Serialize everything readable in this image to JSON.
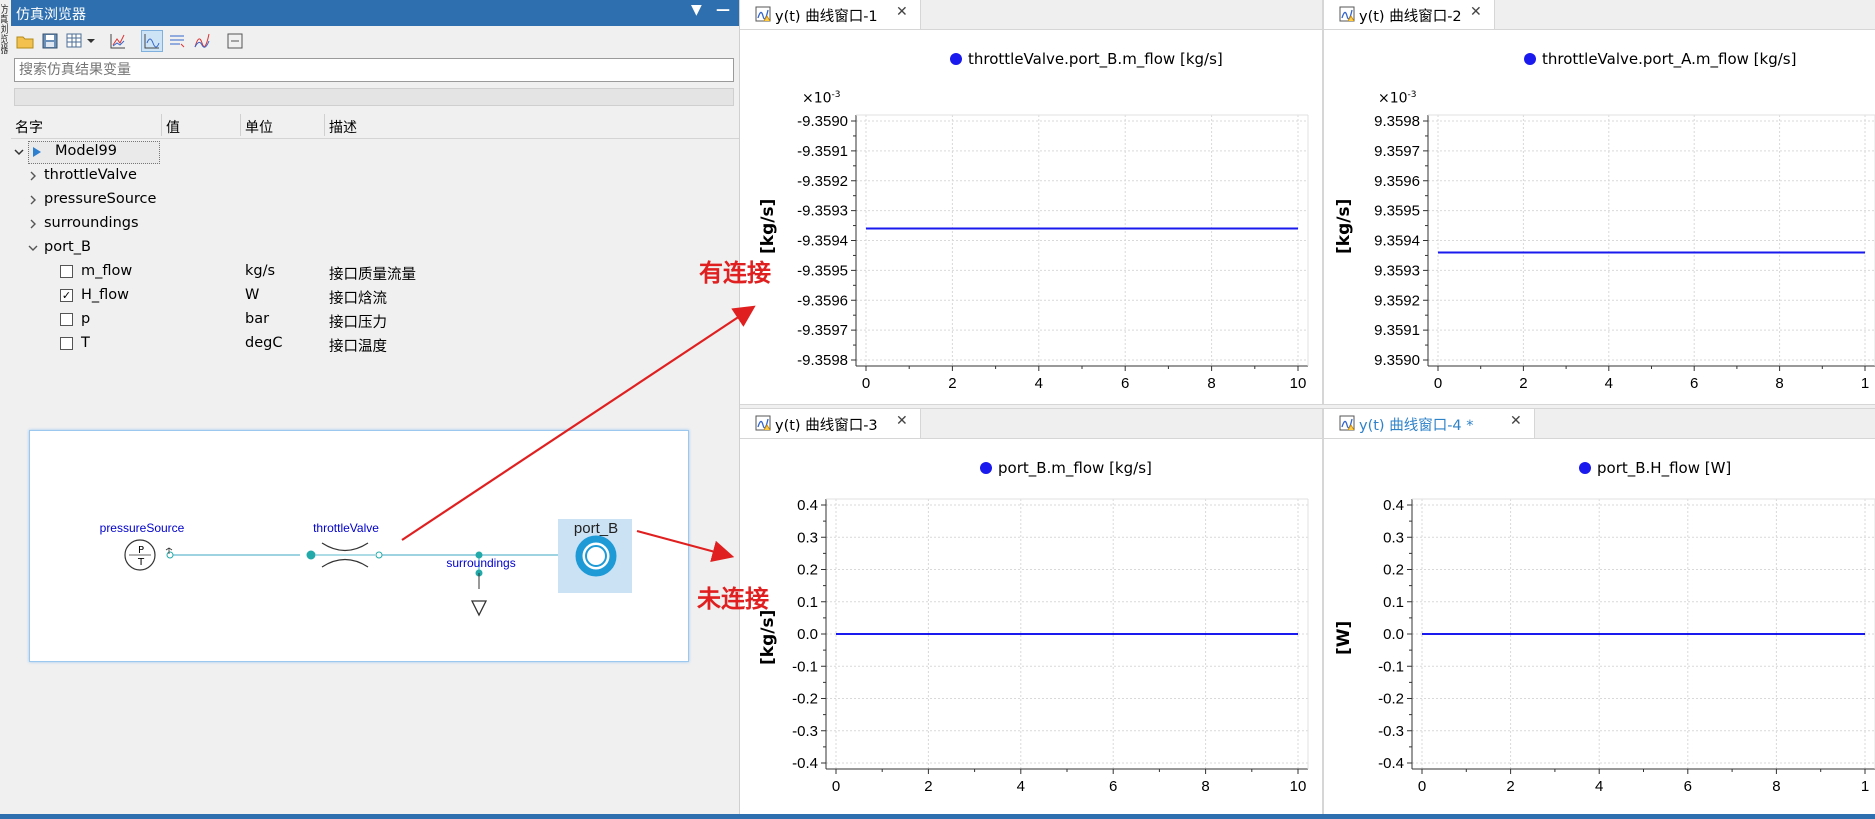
{
  "window": {
    "panel_title": "仿真浏览器",
    "side_tab": "仿真浏览器"
  },
  "search": {
    "placeholder": "搜索仿真结果变量"
  },
  "tree": {
    "columns": [
      "名字",
      "值",
      "单位",
      "描述"
    ],
    "root": "Model99",
    "items": [
      {
        "name": "throttleValve",
        "expanded": false
      },
      {
        "name": "pressureSource",
        "expanded": false
      },
      {
        "name": "surroundings",
        "expanded": false
      },
      {
        "name": "port_B",
        "expanded": true
      }
    ],
    "port_B_children": [
      {
        "name": "m_flow",
        "unit": "kg/s",
        "desc": "接口质量流量",
        "checked": false
      },
      {
        "name": "H_flow",
        "unit": "W",
        "desc": "接口焓流",
        "checked": true
      },
      {
        "name": "p",
        "unit": "bar",
        "desc": "接口压力",
        "checked": false
      },
      {
        "name": "T",
        "unit": "degC",
        "desc": "接口温度",
        "checked": false
      }
    ]
  },
  "diagram": {
    "labels": {
      "pressureSource": "pressureSource",
      "throttleValve": "throttleValve",
      "surroundings": "surroundings",
      "port_B": "port_B",
      "ps_symbol_top": "P",
      "ps_symbol_bottom": "T"
    },
    "colors": {
      "wire": "#7ec6d8",
      "label": "#0000cc",
      "port": "#1e9bd7"
    }
  },
  "annotations": {
    "connected": "有连接",
    "unconnected": "未连接",
    "color": "#e02020"
  },
  "plots": [
    {
      "tab": "y(t) 曲线窗口-1",
      "active": false,
      "chart_data": {
        "type": "line",
        "legend": "throttleValve.port_B.m_flow [kg/s]",
        "ylabel": "[kg/s]",
        "multiplier": "×10",
        "multiplier_exp": "-3",
        "xlim": [
          0,
          10
        ],
        "ylim": [
          -9.3598,
          -9.359
        ],
        "xticks": [
          "0",
          "2",
          "4",
          "6",
          "8",
          "10"
        ],
        "yticks": [
          "-9.3590",
          "-9.3591",
          "-9.3592",
          "-9.3593",
          "-9.3594",
          "-9.3595",
          "-9.3596",
          "-9.3597",
          "-9.3598"
        ],
        "series": [
          {
            "x": [
              0,
              10
            ],
            "y": [
              -9.35936,
              -9.35936
            ]
          }
        ],
        "grid": true
      }
    },
    {
      "tab": "y(t) 曲线窗口-2",
      "active": false,
      "chart_data": {
        "type": "line",
        "legend": "throttleValve.port_A.m_flow [kg/s]",
        "ylabel": "[kg/s]",
        "multiplier": "×10",
        "multiplier_exp": "-3",
        "xlim": [
          0,
          10
        ],
        "ylim": [
          9.359,
          9.3598
        ],
        "xticks": [
          "0",
          "2",
          "4",
          "6",
          "8",
          "1"
        ],
        "yticks": [
          "9.3598",
          "9.3597",
          "9.3596",
          "9.3595",
          "9.3594",
          "9.3593",
          "9.3592",
          "9.3591",
          "9.3590"
        ],
        "series": [
          {
            "x": [
              0,
              10
            ],
            "y": [
              9.35936,
              9.35936
            ]
          }
        ],
        "grid": true
      }
    },
    {
      "tab": "y(t) 曲线窗口-3",
      "active": false,
      "chart_data": {
        "type": "line",
        "legend": "port_B.m_flow [kg/s]",
        "ylabel": "[kg/s]",
        "xlim": [
          0,
          10
        ],
        "ylim": [
          -0.4,
          0.4
        ],
        "xticks": [
          "0",
          "2",
          "4",
          "6",
          "8",
          "10"
        ],
        "yticks": [
          "0.4",
          "0.3",
          "0.2",
          "0.1",
          "0.0",
          "-0.1",
          "-0.2",
          "-0.3",
          "-0.4"
        ],
        "series": [
          {
            "x": [
              0,
              10
            ],
            "y": [
              0,
              0
            ]
          }
        ],
        "grid": true
      }
    },
    {
      "tab": "y(t) 曲线窗口-4 *",
      "active": true,
      "chart_data": {
        "type": "line",
        "legend": "port_B.H_flow [W]",
        "ylabel": "[W]",
        "xlim": [
          0,
          10
        ],
        "ylim": [
          -0.4,
          0.4
        ],
        "xticks": [
          "0",
          "2",
          "4",
          "6",
          "8",
          "1"
        ],
        "yticks": [
          "0.4",
          "0.3",
          "0.2",
          "0.1",
          "0.0",
          "-0.1",
          "-0.2",
          "-0.3",
          "-0.4"
        ],
        "series": [
          {
            "x": [
              0,
              10
            ],
            "y": [
              0,
              0
            ]
          }
        ],
        "grid": true
      }
    }
  ],
  "colors": {
    "accent": "#2e6fb0",
    "series": "#1a1aee",
    "active_tab_text": "#2e82c8"
  }
}
